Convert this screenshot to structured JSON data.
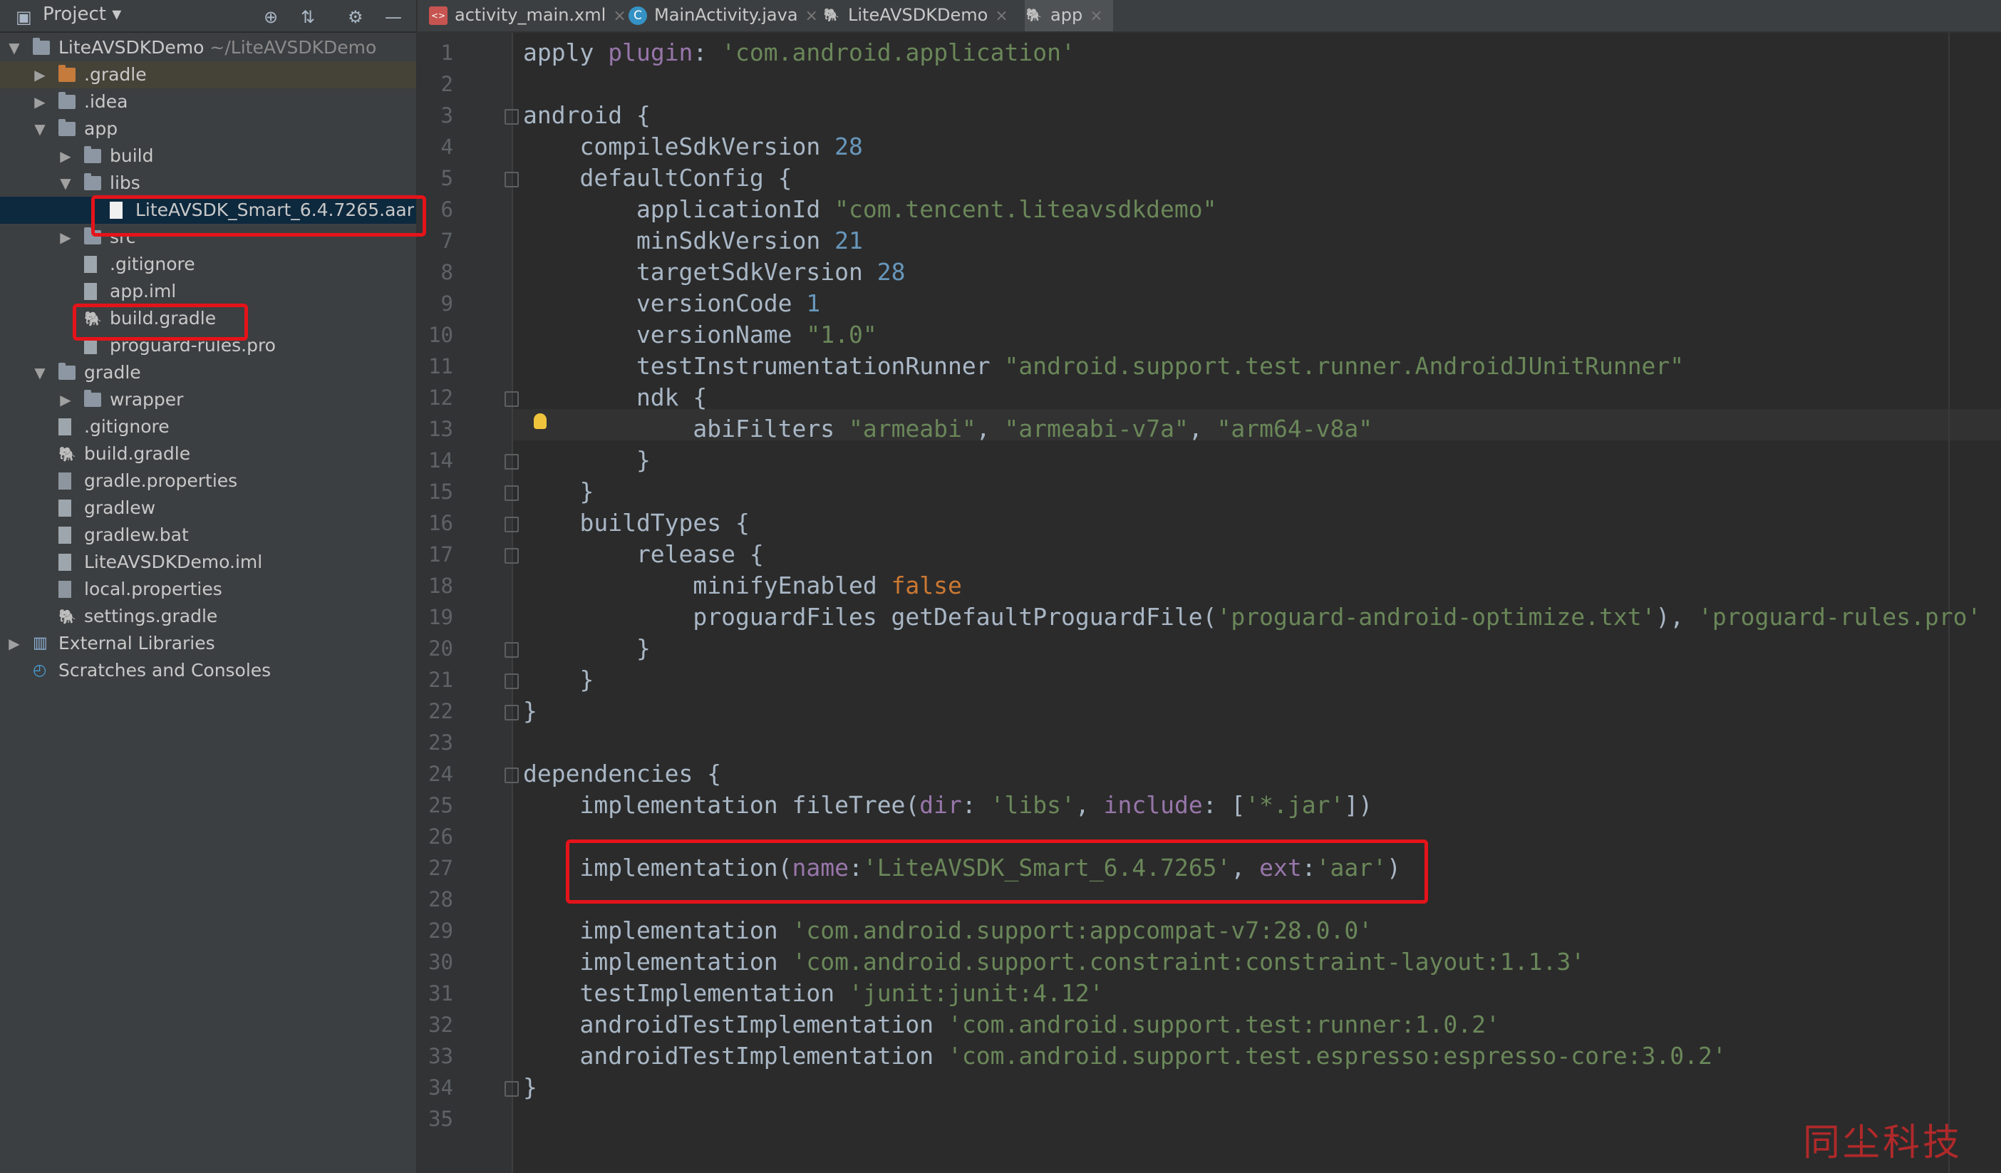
{
  "project_panel": {
    "title": "Project",
    "tree": [
      {
        "label": "LiteAVSDKDemo",
        "suffix": "~/LiteAVSDKDemo",
        "depth": 0,
        "arrow": "down",
        "icon": "module-folder-icon"
      },
      {
        "label": ".gradle",
        "depth": 1,
        "arrow": "right",
        "icon": "folder-orange-icon"
      },
      {
        "label": ".idea",
        "depth": 1,
        "arrow": "right",
        "icon": "folder-icon"
      },
      {
        "label": "app",
        "depth": 1,
        "arrow": "down",
        "icon": "module-folder-icon"
      },
      {
        "label": "build",
        "depth": 2,
        "arrow": "right",
        "icon": "folder-icon"
      },
      {
        "label": "libs",
        "depth": 2,
        "arrow": "down",
        "icon": "folder-icon"
      },
      {
        "label": "LiteAVSDK_Smart_6.4.7265.aar",
        "depth": 3,
        "arrow": "",
        "icon": "file-icon",
        "highlighted": true
      },
      {
        "label": "src",
        "depth": 2,
        "arrow": "right",
        "icon": "folder-icon"
      },
      {
        "label": ".gitignore",
        "depth": 2,
        "arrow": "",
        "icon": "text-file-icon"
      },
      {
        "label": "app.iml",
        "depth": 2,
        "arrow": "",
        "icon": "iml-file-icon"
      },
      {
        "label": "build.gradle",
        "depth": 2,
        "arrow": "",
        "icon": "gradle-icon",
        "highlighted": true
      },
      {
        "label": "proguard-rules.pro",
        "depth": 2,
        "arrow": "",
        "icon": "text-file-icon"
      },
      {
        "label": "gradle",
        "depth": 1,
        "arrow": "down",
        "icon": "folder-icon"
      },
      {
        "label": "wrapper",
        "depth": 2,
        "arrow": "right",
        "icon": "folder-icon"
      },
      {
        "label": ".gitignore",
        "depth": 1,
        "arrow": "",
        "icon": "text-file-icon"
      },
      {
        "label": "build.gradle",
        "depth": 1,
        "arrow": "",
        "icon": "gradle-icon"
      },
      {
        "label": "gradle.properties",
        "depth": 1,
        "arrow": "",
        "icon": "properties-icon"
      },
      {
        "label": "gradlew",
        "depth": 1,
        "arrow": "",
        "icon": "text-file-icon"
      },
      {
        "label": "gradlew.bat",
        "depth": 1,
        "arrow": "",
        "icon": "text-file-icon"
      },
      {
        "label": "LiteAVSDKDemo.iml",
        "depth": 1,
        "arrow": "",
        "icon": "iml-file-icon"
      },
      {
        "label": "local.properties",
        "depth": 1,
        "arrow": "",
        "icon": "properties-icon"
      },
      {
        "label": "settings.gradle",
        "depth": 1,
        "arrow": "",
        "icon": "gradle-icon"
      },
      {
        "label": "External Libraries",
        "depth": 0,
        "arrow": "right",
        "icon": "libraries-icon"
      },
      {
        "label": "Scratches and Consoles",
        "depth": 0,
        "arrow": "",
        "icon": "scratches-icon"
      }
    ]
  },
  "tabs": [
    {
      "label": "activity_main.xml",
      "icon": "xml-icon",
      "active": false
    },
    {
      "label": "MainActivity.java",
      "icon": "java-class-icon",
      "active": false
    },
    {
      "label": "LiteAVSDKDemo",
      "icon": "gradle-icon",
      "active": false
    },
    {
      "label": "app",
      "icon": "gradle-icon",
      "active": true
    }
  ],
  "editor": {
    "line_numbers": [
      "1",
      "2",
      "3",
      "4",
      "5",
      "6",
      "7",
      "8",
      "9",
      "10",
      "11",
      "12",
      "13",
      "14",
      "15",
      "16",
      "17",
      "18",
      "19",
      "20",
      "21",
      "22",
      "23",
      "24",
      "25",
      "26",
      "27",
      "28",
      "29",
      "30",
      "31",
      "32",
      "33",
      "34",
      "35"
    ],
    "lines": [
      [
        [
          "apply ",
          "p"
        ],
        [
          "plugin",
          "i"
        ],
        [
          ": ",
          "p"
        ],
        [
          "'com.android.application'",
          "s"
        ]
      ],
      [],
      [
        [
          "android {",
          "p"
        ]
      ],
      [
        [
          "    compileSdkVersion ",
          "p"
        ],
        [
          "28",
          "n"
        ]
      ],
      [
        [
          "    defaultConfig {",
          "p"
        ]
      ],
      [
        [
          "        applicationId ",
          "p"
        ],
        [
          "\"com.tencent.liteavsdkdemo\"",
          "s"
        ]
      ],
      [
        [
          "        minSdkVersion ",
          "p"
        ],
        [
          "21",
          "n"
        ]
      ],
      [
        [
          "        targetSdkVersion ",
          "p"
        ],
        [
          "28",
          "n"
        ]
      ],
      [
        [
          "        versionCode ",
          "p"
        ],
        [
          "1",
          "n"
        ]
      ],
      [
        [
          "        versionName ",
          "p"
        ],
        [
          "\"1.0\"",
          "s"
        ]
      ],
      [
        [
          "        testInstrumentationRunner ",
          "p"
        ],
        [
          "\"android.support.test.runner.AndroidJUnitRunner\"",
          "s"
        ]
      ],
      [
        [
          "        ndk {",
          "p"
        ]
      ],
      [
        [
          "            abiFilters ",
          "p"
        ],
        [
          "\"armeabi\"",
          "s"
        ],
        [
          ", ",
          "p"
        ],
        [
          "\"armeabi-v7a\"",
          "s"
        ],
        [
          ", ",
          "p"
        ],
        [
          "\"arm64-v8a\"",
          "s"
        ]
      ],
      [
        [
          "        }",
          "p"
        ]
      ],
      [
        [
          "    }",
          "p"
        ]
      ],
      [
        [
          "    buildTypes {",
          "p"
        ]
      ],
      [
        [
          "        release {",
          "p"
        ]
      ],
      [
        [
          "            minifyEnabled ",
          "p"
        ],
        [
          "false",
          "k"
        ]
      ],
      [
        [
          "            proguardFiles getDefaultProguardFile(",
          "p"
        ],
        [
          "'proguard-android-optimize.txt'",
          "s"
        ],
        [
          "), ",
          "p"
        ],
        [
          "'proguard-rules.pro'",
          "s"
        ]
      ],
      [
        [
          "        }",
          "p"
        ]
      ],
      [
        [
          "    }",
          "p"
        ]
      ],
      [
        [
          "}",
          "p"
        ]
      ],
      [],
      [
        [
          "dependencies {",
          "p"
        ]
      ],
      [
        [
          "    implementation fileTree(",
          "p"
        ],
        [
          "dir",
          "i"
        ],
        [
          ": ",
          "p"
        ],
        [
          "'libs'",
          "s"
        ],
        [
          ", ",
          "p"
        ],
        [
          "include",
          "i"
        ],
        [
          ": [",
          "p"
        ],
        [
          "'*.jar'",
          "s"
        ],
        [
          "])",
          "p"
        ]
      ],
      [],
      [
        [
          "    implementation(",
          "p"
        ],
        [
          "name",
          "i"
        ],
        [
          ":",
          "p"
        ],
        [
          "'LiteAVSDK_Smart_6.4.7265'",
          "s"
        ],
        [
          ", ",
          "p"
        ],
        [
          "ext",
          "i"
        ],
        [
          ":",
          "p"
        ],
        [
          "'aar'",
          "s"
        ],
        [
          ")",
          "p"
        ]
      ],
      [],
      [
        [
          "    implementation ",
          "p"
        ],
        [
          "'com.android.support:appcompat-v7:28.0.0'",
          "s"
        ]
      ],
      [
        [
          "    implementation ",
          "p"
        ],
        [
          "'com.android.support.constraint:constraint-layout:1.1.3'",
          "s"
        ]
      ],
      [
        [
          "    testImplementation ",
          "p"
        ],
        [
          "'junit:junit:4.12'",
          "s"
        ]
      ],
      [
        [
          "    androidTestImplementation ",
          "p"
        ],
        [
          "'com.android.support.test:runner:1.0.2'",
          "s"
        ]
      ],
      [
        [
          "    androidTestImplementation ",
          "p"
        ],
        [
          "'com.android.support.test.espresso:espresso-core:3.0.2'",
          "s"
        ]
      ],
      [
        [
          "}",
          "p"
        ]
      ],
      []
    ]
  },
  "watermark": "同尘科技",
  "colors": {
    "keyword": "#cc7832",
    "string": "#6a8759",
    "number": "#6897bb",
    "named_arg": "#9876aa",
    "plain": "#a9b7c6",
    "highlight_box": "#e5131a"
  }
}
